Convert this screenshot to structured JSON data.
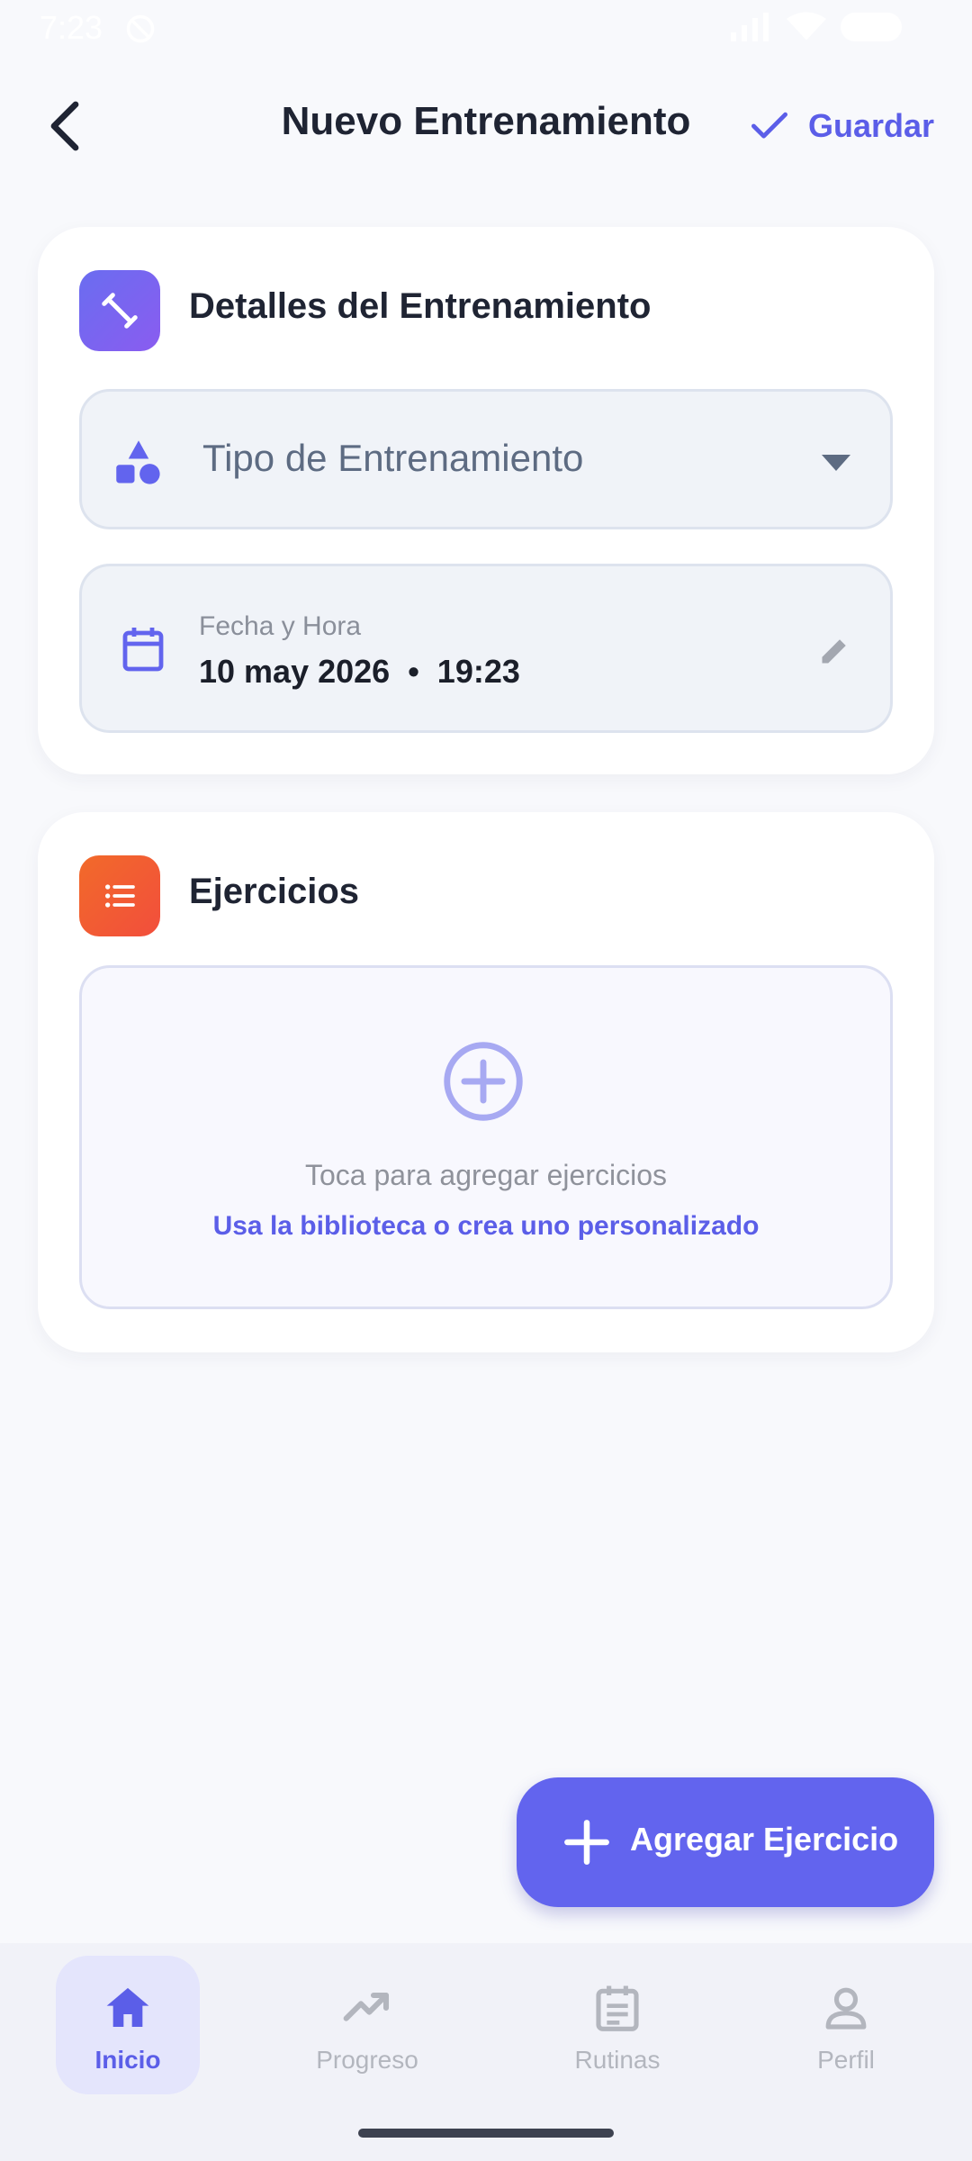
{
  "status_bar": {
    "time": "7:23"
  },
  "app_bar": {
    "title": "Nuevo Entrenamiento",
    "save_label": "Guardar"
  },
  "details_card": {
    "title": "Detalles del Entrenamiento",
    "type_field": {
      "placeholder": "Tipo de Entrenamiento"
    },
    "date_field": {
      "label": "Fecha y Hora",
      "value": "10 may 2026  •  19:23"
    }
  },
  "exercises_card": {
    "title": "Ejercicios",
    "empty_text": "Toca para agregar ejercicios",
    "empty_link": "Usa la biblioteca o crea uno personalizado"
  },
  "fab": {
    "label": "Agregar Ejercicio"
  },
  "bottom_nav": {
    "items": [
      {
        "label": "Inicio",
        "icon": "home-icon",
        "active": true
      },
      {
        "label": "Progreso",
        "icon": "trending-up-icon",
        "active": false
      },
      {
        "label": "Rutinas",
        "icon": "calendar-list-icon",
        "active": false
      },
      {
        "label": "Perfil",
        "icon": "person-icon",
        "active": false
      }
    ]
  },
  "colors": {
    "accent": "#6264ee",
    "accent_text": "#5b5ee8",
    "orange": "#f25a32",
    "background": "#f8f9fc"
  }
}
